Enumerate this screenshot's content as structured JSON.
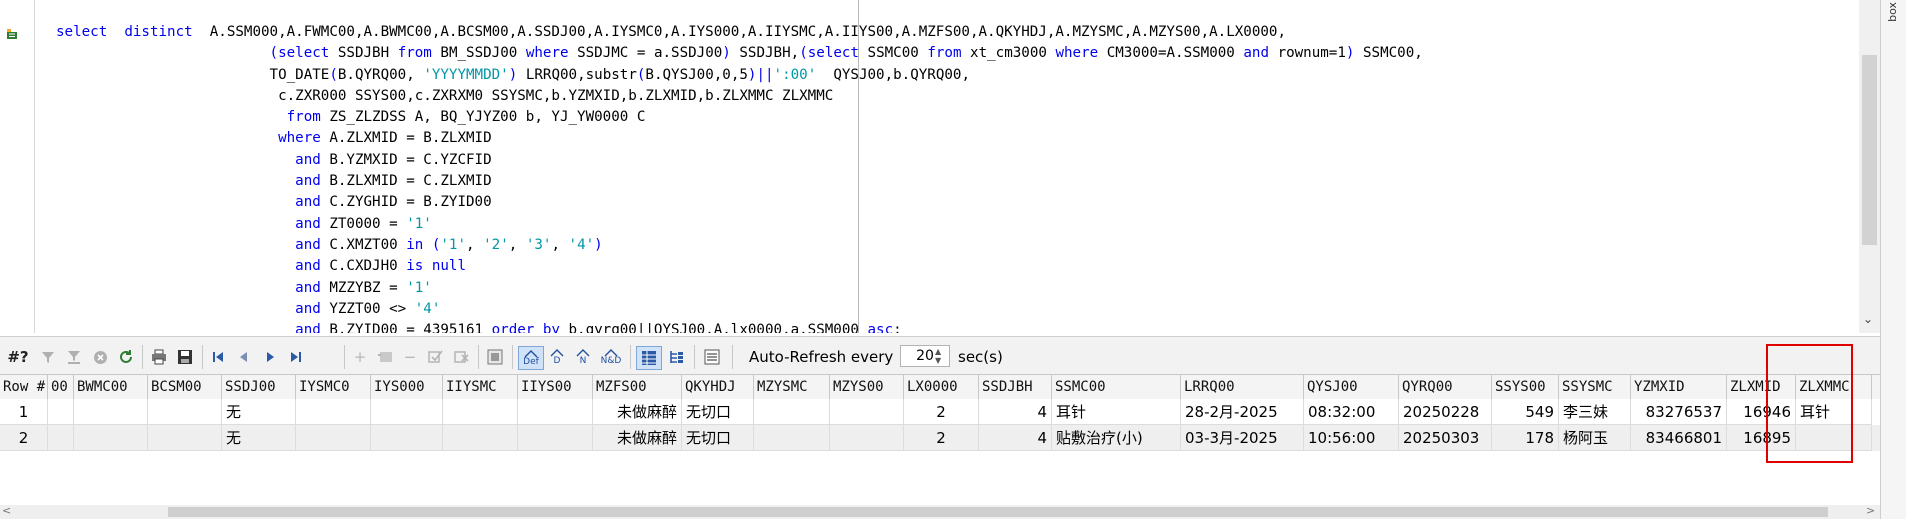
{
  "editor": {
    "lines": [
      [
        [
          "kw",
          "select  distinct  "
        ],
        [
          "t",
          "A.SSM000,A.FWMC00,A.BWMC00,A.BCSM00,A.SSDJ00,A.IYSMC0,A.IYS000,A.IIYSMC,A.IIYS00,A.MZFS00,A.QKYHDJ,A.MZYSMC,A.MZYS00,A.LX0000,"
        ]
      ],
      [
        [
          "t",
          "                         "
        ],
        [
          "op",
          "("
        ],
        [
          "kw",
          "select "
        ],
        [
          "t",
          "SSDJBH "
        ],
        [
          "kw",
          "from "
        ],
        [
          "t",
          "BM_SSDJ00 "
        ],
        [
          "kw",
          "where "
        ],
        [
          "t",
          "SSDJMC = a.SSDJ00"
        ],
        [
          "op",
          ") "
        ],
        [
          "t",
          "SSDJBH,"
        ],
        [
          "op",
          "("
        ],
        [
          "kw",
          "select "
        ],
        [
          "t",
          "SSMC00 "
        ],
        [
          "kw",
          "from "
        ],
        [
          "t",
          "xt_cm3000 "
        ],
        [
          "kw",
          "where "
        ],
        [
          "t",
          "CM3000=A.SSM000 "
        ],
        [
          "kw",
          "and "
        ],
        [
          "t",
          "rownum=1"
        ],
        [
          "op",
          ") "
        ],
        [
          "t",
          "SSMC00,"
        ]
      ],
      [
        [
          "t",
          "                         TO_DATE"
        ],
        [
          "op",
          "("
        ],
        [
          "t",
          "B.QYRQ00, "
        ],
        [
          "str",
          "'YYYYMMDD'"
        ],
        [
          "op",
          ") "
        ],
        [
          "t",
          "LRRQ00,substr"
        ],
        [
          "op",
          "("
        ],
        [
          "t",
          "B.QYSJ00,0,5"
        ],
        [
          "op",
          ")||"
        ],
        [
          "str",
          "':00'"
        ],
        [
          "t",
          "  QYSJ00,b.QYRQ00,"
        ]
      ],
      [
        [
          "t",
          "                          c.ZXR000 SSYS00,c.ZXRXM0 SSYSMC,b.YZMXID,b.ZLXMID,b.ZLXMMC ZLXMMC"
        ]
      ],
      [
        [
          "t",
          "                           "
        ],
        [
          "kw",
          "from "
        ],
        [
          "t",
          "ZS_ZLZDSS A, BQ_YJYZ00 b, YJ_YW0000 C"
        ]
      ],
      [
        [
          "t",
          "                          "
        ],
        [
          "kw",
          "where "
        ],
        [
          "t",
          "A.ZLXMID = B.ZLXMID"
        ]
      ],
      [
        [
          "t",
          "                            "
        ],
        [
          "kw",
          "and "
        ],
        [
          "t",
          "B.YZMXID = C.YZCFID"
        ]
      ],
      [
        [
          "t",
          "                            "
        ],
        [
          "kw",
          "and "
        ],
        [
          "t",
          "B.ZLXMID = C.ZLXMID"
        ]
      ],
      [
        [
          "t",
          "                            "
        ],
        [
          "kw",
          "and "
        ],
        [
          "t",
          "C.ZYGHID = B.ZYID00"
        ]
      ],
      [
        [
          "t",
          "                            "
        ],
        [
          "kw",
          "and "
        ],
        [
          "t",
          "ZT0000 = "
        ],
        [
          "str",
          "'1'"
        ]
      ],
      [
        [
          "t",
          "                            "
        ],
        [
          "kw",
          "and "
        ],
        [
          "t",
          "C.XMZT00 "
        ],
        [
          "kw",
          "in "
        ],
        [
          "op",
          "("
        ],
        [
          "str",
          "'1'"
        ],
        [
          "t",
          ", "
        ],
        [
          "str",
          "'2'"
        ],
        [
          "t",
          ", "
        ],
        [
          "str",
          "'3'"
        ],
        [
          "t",
          ", "
        ],
        [
          "str",
          "'4'"
        ],
        [
          "op",
          ")"
        ]
      ],
      [
        [
          "t",
          "                            "
        ],
        [
          "kw",
          "and "
        ],
        [
          "t",
          "C.CXDJH0 "
        ],
        [
          "kw",
          "is null"
        ]
      ],
      [
        [
          "t",
          "                            "
        ],
        [
          "kw",
          "and "
        ],
        [
          "t",
          "MZZYBZ = "
        ],
        [
          "str",
          "'1'"
        ]
      ],
      [
        [
          "t",
          "                            "
        ],
        [
          "kw",
          "and "
        ],
        [
          "t",
          "YZZT00 <> "
        ],
        [
          "str",
          "'4'"
        ]
      ],
      [
        [
          "t",
          "                            "
        ],
        [
          "kw",
          "and "
        ],
        [
          "t",
          "B.ZYID00 = 4395161 "
        ],
        [
          "kw",
          "order by "
        ],
        [
          "t",
          "b.qyrq00||QYSJ00,A.lx0000,a.SSM000 "
        ],
        [
          "kw",
          "asc"
        ],
        [
          "t",
          ";"
        ]
      ]
    ]
  },
  "right_panel_label": "box",
  "toolbar": {
    "rownum_label": "#?",
    "auto_refresh_label": "Auto-Refresh every",
    "interval_value": "20",
    "secs_label": "sec(s)",
    "def_label": "Def",
    "d_label": "D",
    "n_label": "N",
    "nd_label": "N&D"
  },
  "grid": {
    "columns": [
      "Row #",
      "00",
      "BWMC00",
      "BCSM00",
      "SSDJ00",
      "IYSMC0",
      "IYS000",
      "IIYSMC",
      "IIYS00",
      "MZFS00",
      "QKYHDJ",
      "MZYSMC",
      "MZYS00",
      "LX0000",
      "SSDJBH",
      "SSMC00",
      "LRRQ00",
      "QYSJ00",
      "QYRQ00",
      "SSYS00",
      "SSYSMC",
      "YZMXID",
      "ZLXMID",
      "ZLXMMC"
    ],
    "rows": [
      {
        "row": "1",
        "BWMC00": "",
        "BCSM00": "",
        "SSDJ00": "无",
        "MZFS00": "未做麻醉",
        "QKYHDJ": "无切口",
        "LX0000": "2",
        "SSDJBH": "4",
        "SSMC00": "耳针",
        "LRRQ00": "28-2月-2025",
        "QYSJ00": "08:32:00",
        "QYRQ00": "20250228",
        "SSYS00": "549",
        "SSYSMC": "李三妹",
        "YZMXID": "83276537",
        "ZLXMID": "16946",
        "ZLXMMC": "耳针"
      },
      {
        "row": "2",
        "BWMC00": "",
        "BCSM00": "",
        "SSDJ00": "无",
        "MZFS00": "未做麻醉",
        "QKYHDJ": "无切口",
        "LX0000": "2",
        "SSDJBH": "4",
        "SSMC00": "贴敷治疗(小)",
        "LRRQ00": "03-3月-2025",
        "QYSJ00": "10:56:00",
        "QYRQ00": "20250303",
        "SSYS00": "178",
        "SSYSMC": "杨阿玉",
        "YZMXID": "83466801",
        "ZLXMID": "16895",
        "ZLXMMC": ""
      }
    ]
  },
  "colors": {
    "keyword": "#0000ee",
    "string": "#0097a7",
    "highlight_box": "#e00000"
  }
}
